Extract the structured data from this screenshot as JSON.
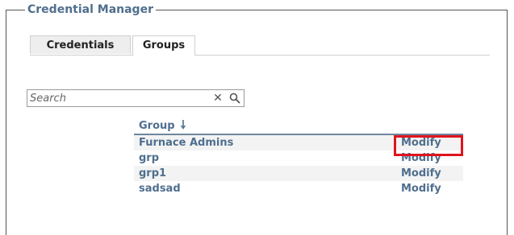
{
  "window": {
    "title": "Credential Manager"
  },
  "tabs": [
    {
      "label": "Credentials",
      "active": false
    },
    {
      "label": "Groups",
      "active": true
    }
  ],
  "search": {
    "placeholder": "Search",
    "value": "",
    "clear_icon": "close-icon",
    "search_icon": "search-icon"
  },
  "table": {
    "header": "Group",
    "sort_icon": "sort-down-arrow-icon",
    "rows": [
      {
        "name": "Furnace Admins",
        "action": "Modify"
      },
      {
        "name": "grp",
        "action": "Modify"
      },
      {
        "name": "grp1",
        "action": "Modify"
      },
      {
        "name": "sadsad",
        "action": "Modify"
      }
    ]
  },
  "colors": {
    "accent": "#4f6f8e",
    "highlight": "#e0141e",
    "row_shade": "#f3f3f3"
  }
}
